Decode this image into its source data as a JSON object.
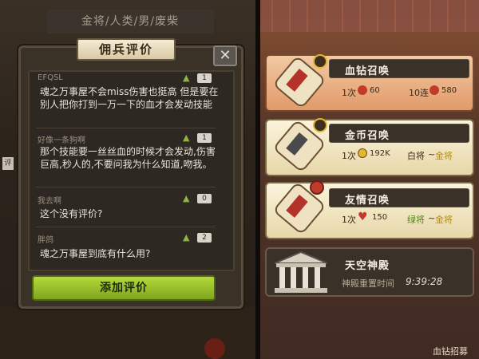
{
  "left": {
    "top_title": "金将/人类/男/废柴",
    "panel_title": "佣兵评价",
    "close_icon": "✕",
    "side_tab": "评",
    "reviews": [
      {
        "user": "EFQSL",
        "likes": "1",
        "text": "魂之万事屋不会miss伤害也挺高 但是要在别人把你打到一万一下的血才会发动技能"
      },
      {
        "user": "好像一条狗啊",
        "likes": "1",
        "text": "那个技能要一丝丝血的时候才会发动,伤害巨高,秒人的,不要问我为什么知道,吻我。"
      },
      {
        "user": "我去啊",
        "likes": "0",
        "text": "这个没有评价?"
      },
      {
        "user": "胖鸽",
        "likes": "2",
        "text": "魂之万事屋到底有什么用?"
      }
    ],
    "add_button": "添加评价"
  },
  "right": {
    "cards": [
      {
        "title": "血钻召唤",
        "line1_a": "1次",
        "line1_a_val": "60",
        "line1_b": "10连",
        "line1_b_val": "580",
        "accent": "#e9a677"
      },
      {
        "title": "金币召唤",
        "line1_a": "1次",
        "line1_a_val": "192K",
        "range_from": "白将",
        "range_sep": "~",
        "range_to": "金将"
      },
      {
        "title": "友情召唤",
        "line1_a": "1次",
        "line1_a_val": "150",
        "range_from": "绿将",
        "range_sep": "~",
        "range_to": "金将"
      },
      {
        "title": "天空神殿",
        "subtitle": "神殿重置时间",
        "timer": "9:39:28"
      }
    ],
    "footer": "血钻招募"
  },
  "colors": {
    "gold": "#e6b62a",
    "green": "#6fa61f",
    "red": "#c23b2a",
    "highlight": "#e9a677"
  }
}
